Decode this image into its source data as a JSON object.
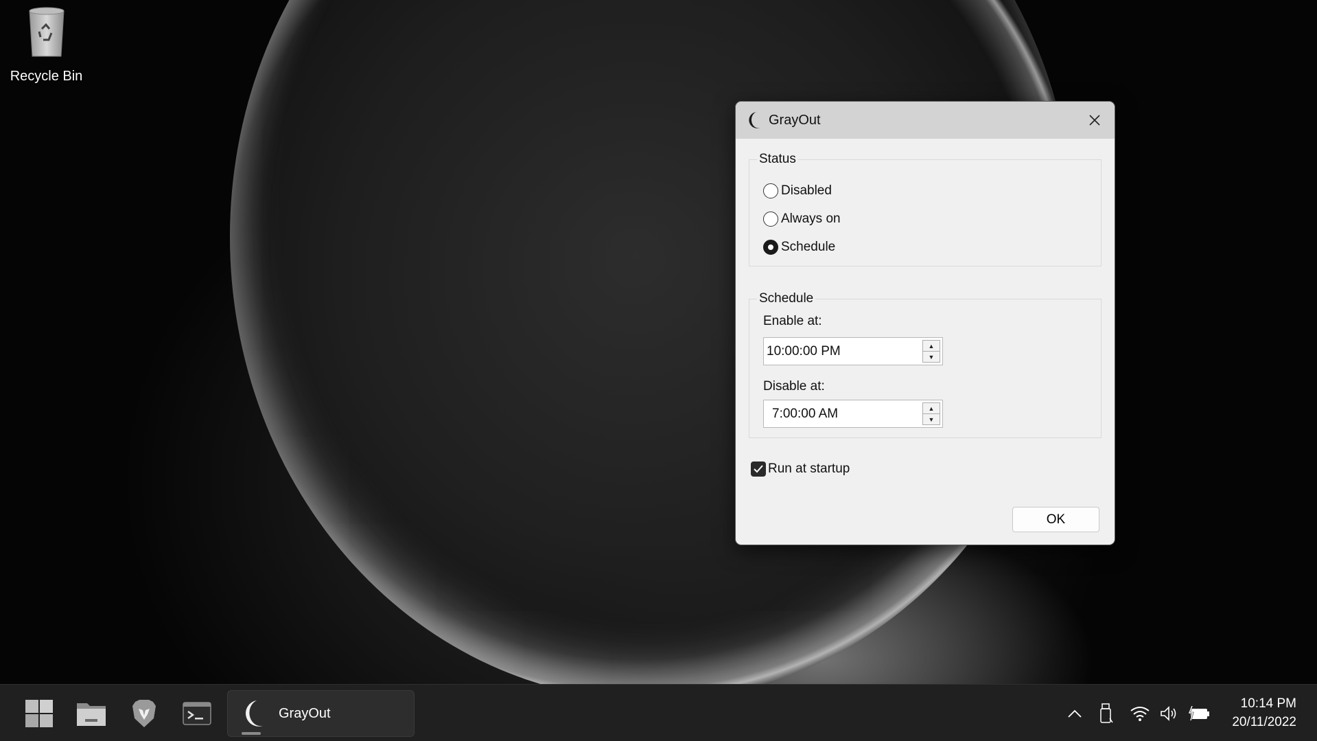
{
  "desktop": {
    "icons": [
      {
        "label": "Recycle Bin",
        "icon": "recycle-bin-icon"
      }
    ]
  },
  "dialog": {
    "title": "GrayOut",
    "title_icon": "moon-icon",
    "close_icon": "close-icon",
    "status_group": {
      "legend": "Status",
      "options": [
        {
          "label": "Disabled",
          "checked": false
        },
        {
          "label": "Always on",
          "checked": false
        },
        {
          "label": "Schedule",
          "checked": true
        }
      ]
    },
    "schedule_group": {
      "legend": "Schedule",
      "enable_label": "Enable at:",
      "enable_value": "10:00:00 PM",
      "disable_label": "Disable at:",
      "disable_value": "7:00:00 AM"
    },
    "run_at_startup": {
      "label": "Run at startup",
      "checked": true
    },
    "ok_label": "OK"
  },
  "taskbar": {
    "pinned": [
      {
        "name": "start",
        "icon": "windows-start-icon"
      },
      {
        "name": "file-explorer",
        "icon": "folder-icon"
      },
      {
        "name": "brave",
        "icon": "brave-lion-icon"
      },
      {
        "name": "terminal",
        "icon": "terminal-icon"
      }
    ],
    "running_app": {
      "label": "GrayOut",
      "icon": "moon-icon"
    },
    "tray_icons": [
      "chevron-up-icon",
      "usb-drive-icon",
      "wifi-icon",
      "speaker-icon",
      "battery-charging-icon"
    ],
    "clock": {
      "time": "10:14 PM",
      "date": "20/11/2022"
    }
  }
}
